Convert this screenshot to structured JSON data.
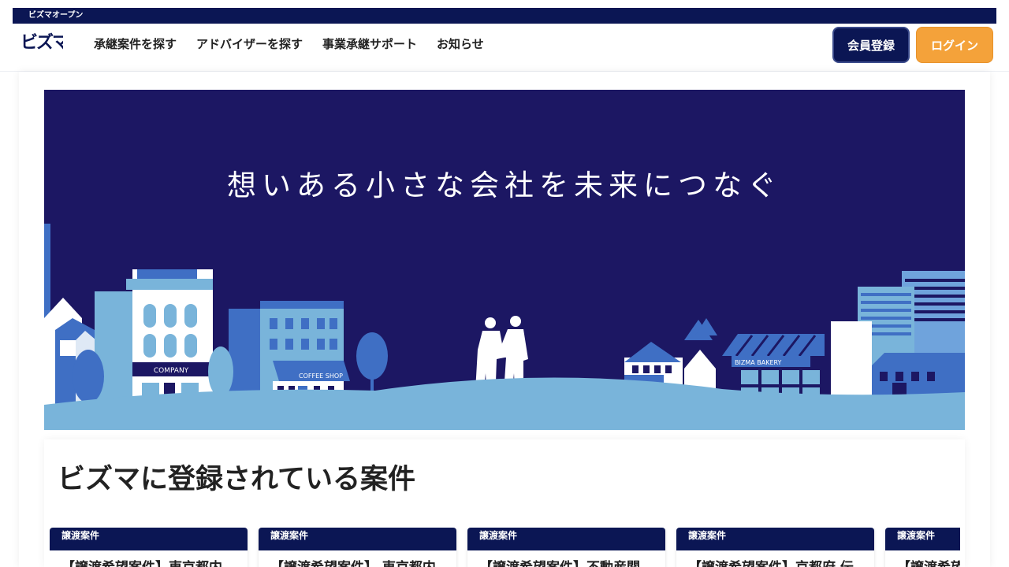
{
  "topbar": {
    "label": "ビズマオープン"
  },
  "header": {
    "logo_text": "ビズマ",
    "nav": [
      {
        "label": "承継案件を探す"
      },
      {
        "label": "アドバイザーを探す"
      },
      {
        "label": "事業承継サポート"
      },
      {
        "label": "お知らせ"
      }
    ],
    "register_label": "会員登録",
    "login_label": "ログイン"
  },
  "hero": {
    "tagline": "想いある小さな会社を未来につなぐ",
    "signs": {
      "company": "COMPANY",
      "coffee": "COFFEE SHOP",
      "bakery": "BIZMA BAKERY"
    }
  },
  "listings": {
    "title": "ビズマに登録されている案件",
    "cards": [
      {
        "badge": "譲渡案件",
        "title": "【譲渡希望案件】東京都内"
      },
      {
        "badge": "譲渡案件",
        "title": "【譲渡希望案件】 東京都内"
      },
      {
        "badge": "譲渡案件",
        "title": "【譲渡希望案件】不動産関"
      },
      {
        "badge": "譲渡案件",
        "title": "【譲渡希望案件】京都府 伝"
      },
      {
        "badge": "譲渡案件",
        "title": "【譲渡希望"
      }
    ]
  },
  "colors": {
    "navy": "#0b1654",
    "hero_bg": "#1c1763",
    "login": "#f4a23a"
  }
}
